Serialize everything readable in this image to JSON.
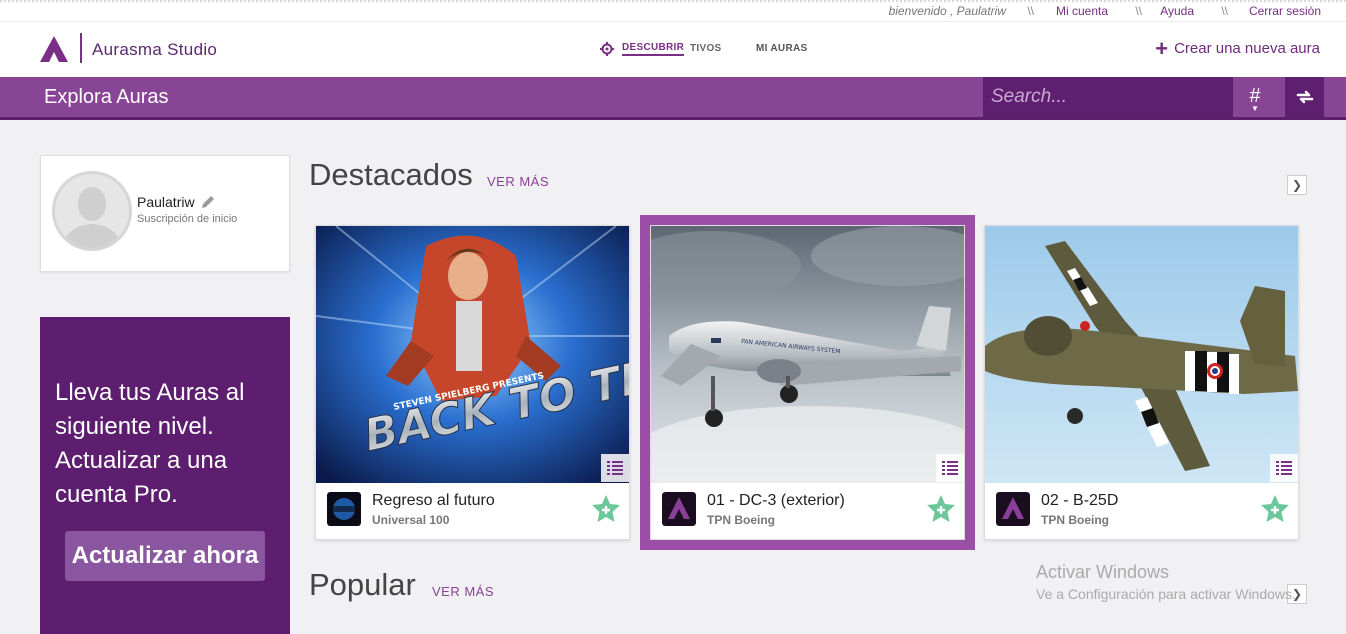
{
  "util": {
    "greeting": "bienvenido , Paulatriw",
    "separator": "\\\\",
    "my_account": "Mi cuenta",
    "help": "Ayuda",
    "logout": "Cerrar sesión"
  },
  "header": {
    "brand": "Aurasma Studio",
    "nav_discover": "DESCUBRIR",
    "nav_partial": "TIVOS",
    "nav_my_auras": "MI AURAS",
    "create_label": "Crear una nueva aura",
    "create_icon": "plus-icon"
  },
  "explore": {
    "title": "Explora Auras",
    "search_placeholder": "Search...",
    "hash_label": "#",
    "refresh_icon": "refresh-icon"
  },
  "profile": {
    "username": "Paulatriw",
    "subscription": "Suscripción de inicio"
  },
  "upgrade": {
    "message": "Lleva tus Auras al siguiente nivel. Actualizar a una cuenta Pro.",
    "button": "Actualizar ahora"
  },
  "featured": {
    "title": "Destacados",
    "more": "VER MÁS",
    "cards": [
      {
        "name": "Regreso al futuro",
        "owner": "Universal 100",
        "poster_title": "BACK TO THE FUTURE",
        "poster_credit": "STEVEN SPIELBERG PRESENTS"
      },
      {
        "name": "01 - DC-3 (exterior)",
        "owner": "TPN Boeing",
        "livery": "PAN AMERICAN AIRWAYS SYSTEM"
      },
      {
        "name": "02 - B-25D",
        "owner": "TPN Boeing"
      }
    ]
  },
  "popular": {
    "title": "Popular",
    "more": "VER MÁS"
  },
  "watermark": {
    "line1": "Activar Windows",
    "line2": "Ve a Configuración para activar Windows."
  },
  "colors": {
    "brand_purple": "#884596",
    "dark_purple": "#5e1e6f",
    "accent_green": "#6cc79a"
  }
}
